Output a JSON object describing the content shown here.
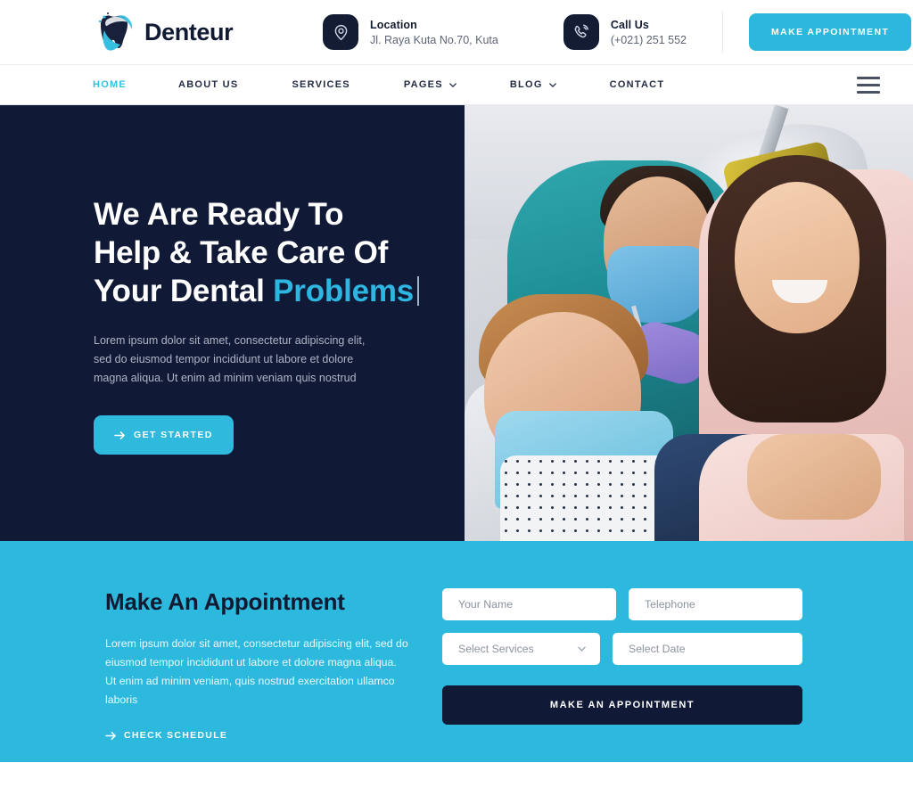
{
  "brand": {
    "name": "Denteur",
    "logo_icon": "tooth-logo-icon"
  },
  "header": {
    "location": {
      "icon": "map-pin-icon",
      "title": "Location",
      "value": "Jl. Raya Kuta No.70, Kuta"
    },
    "call": {
      "icon": "phone-ring-icon",
      "title": "Call Us",
      "value": "(+021) 251 552"
    },
    "appointment_button": "MAKE APPOINTMENT"
  },
  "nav": {
    "items": [
      {
        "label": "HOME",
        "active": true,
        "has_dropdown": false
      },
      {
        "label": "ABOUT US",
        "active": false,
        "has_dropdown": false
      },
      {
        "label": "SERVICES",
        "active": false,
        "has_dropdown": false
      },
      {
        "label": "PAGES",
        "active": false,
        "has_dropdown": true
      },
      {
        "label": "BLOG",
        "active": false,
        "has_dropdown": true
      },
      {
        "label": "CONTACT",
        "active": false,
        "has_dropdown": false
      }
    ],
    "menu_icon": "hamburger-menu-icon"
  },
  "hero": {
    "heading_line1": "We Are Ready To",
    "heading_line2": "Help & Take Care Of",
    "heading_line3_plain": "Your Dental ",
    "heading_line3_accent": "Problems",
    "paragraph": "Lorem ipsum dolor sit amet, consectetur adipiscing elit, sed do eiusmod tempor incididunt ut labore et dolore magna aliqua. Ut enim ad minim veniam quis nostrud",
    "cta_label": "GET STARTED",
    "cta_icon": "arrow-right-icon",
    "image_alt": "dentist-treating-child-patient-photo"
  },
  "appointment": {
    "title": "Make An Appointment",
    "paragraph": "Lorem ipsum dolor sit amet, consectetur adipiscing elit, sed do eiusmod tempor incididunt ut labore et dolore magna aliqua. Ut enim ad minim veniam, quis nostrud exercitation ullamco laboris",
    "link_label": "CHECK SCHEDULE",
    "link_icon": "arrow-right-icon",
    "form": {
      "name_placeholder": "Your Name",
      "name_value": "",
      "phone_placeholder": "Telephone",
      "phone_value": "",
      "service_selected": "Select Services",
      "service_caret_icon": "chevron-down-icon",
      "date_placeholder": "Select Date",
      "date_value": "",
      "submit_label": "MAKE AN APPOINTMENT"
    }
  },
  "colors": {
    "accent_cyan": "#2db9dd",
    "dark_navy": "#101936",
    "nav_active": "#35bfe0",
    "heading_accent": "#2eb6e2",
    "text_muted": "#aeb6c6"
  }
}
